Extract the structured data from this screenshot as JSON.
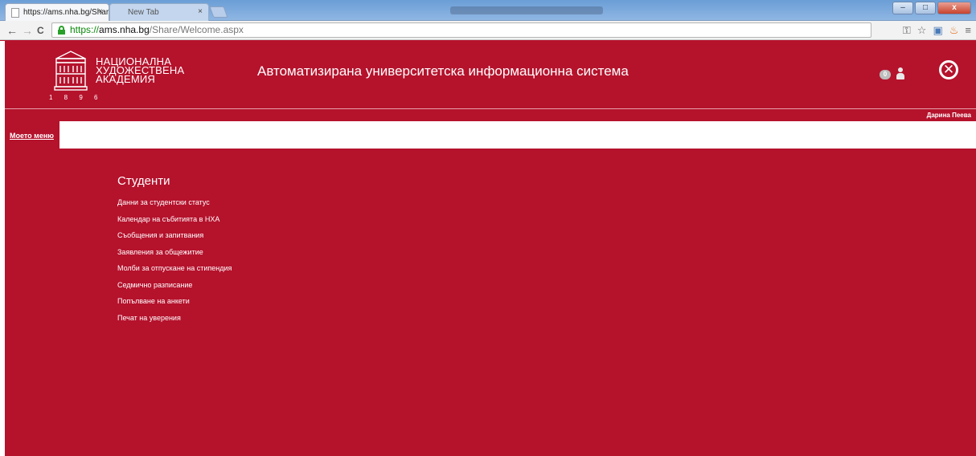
{
  "browser": {
    "tabs": [
      {
        "title": "https://ams.nha.bg/Share",
        "close": "×",
        "active": true
      },
      {
        "title": "New Tab",
        "close": "×",
        "active": false
      }
    ],
    "window_controls": {
      "minimize": "–",
      "maximize": "□",
      "close": "x"
    },
    "nav": {
      "back": "←",
      "forward": "→",
      "reload": "C"
    },
    "url": {
      "scheme": "https://",
      "host": "ams.nha.bg",
      "path": "/Share/Welcome.aspx"
    },
    "extensions": [
      "key-icon",
      "star-icon",
      "extension-icon",
      "flame-icon",
      "menu-icon"
    ]
  },
  "header": {
    "logo_text": [
      "НАЦИОНАЛНА",
      "ХУДОЖЕСТВЕНА",
      "АКАДЕМИЯ"
    ],
    "logo_year": "1 8 9 6",
    "app_title": "Автоматизирана университетска информационна система",
    "notification_count": "0",
    "user_name": "Дарина Пеева"
  },
  "menu": {
    "my_menu": "Моето меню"
  },
  "students": {
    "title": "Студенти",
    "items": [
      "Данни за студентски статус",
      "Календар на събитията в НХА",
      "Съобщения и запитвания",
      "Заявления за общежитие",
      "Молби за отпускане на стипендия",
      "Седмично разписание",
      "Попълване на анкети",
      "Печат на уверения"
    ]
  },
  "colors": {
    "brand": "#b5122c",
    "text": "#ffffff"
  }
}
